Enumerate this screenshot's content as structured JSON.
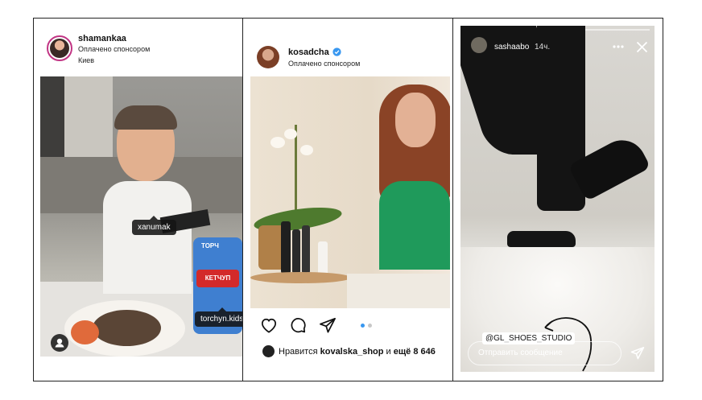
{
  "post1": {
    "username": "shamankaa",
    "sponsored": "Оплачено спонсором",
    "location": "Киев",
    "tags": [
      "xanumak",
      "torchyn.kids"
    ],
    "product_label_top": "ТОРЧ",
    "product_label": "КЕТЧУП"
  },
  "post2": {
    "username": "kosadcha",
    "sponsored": "Оплачено спонсором",
    "likes_prefix": "Нравится ",
    "likes_user": "kovalska_shop",
    "likes_mid": " и ",
    "likes_count": "ещё 8 646",
    "carousel": {
      "count": 2,
      "active": 0
    }
  },
  "story": {
    "username": "sashaabo",
    "time": "14ч.",
    "mention": "@GL_SHOES_STUDIO",
    "placeholder": "Отправить сообщение",
    "progress_segments": 12
  },
  "colors": {
    "verified": "#3897f0",
    "carousel_active": "#3897f0",
    "carousel_inactive": "#c7c7c7"
  }
}
